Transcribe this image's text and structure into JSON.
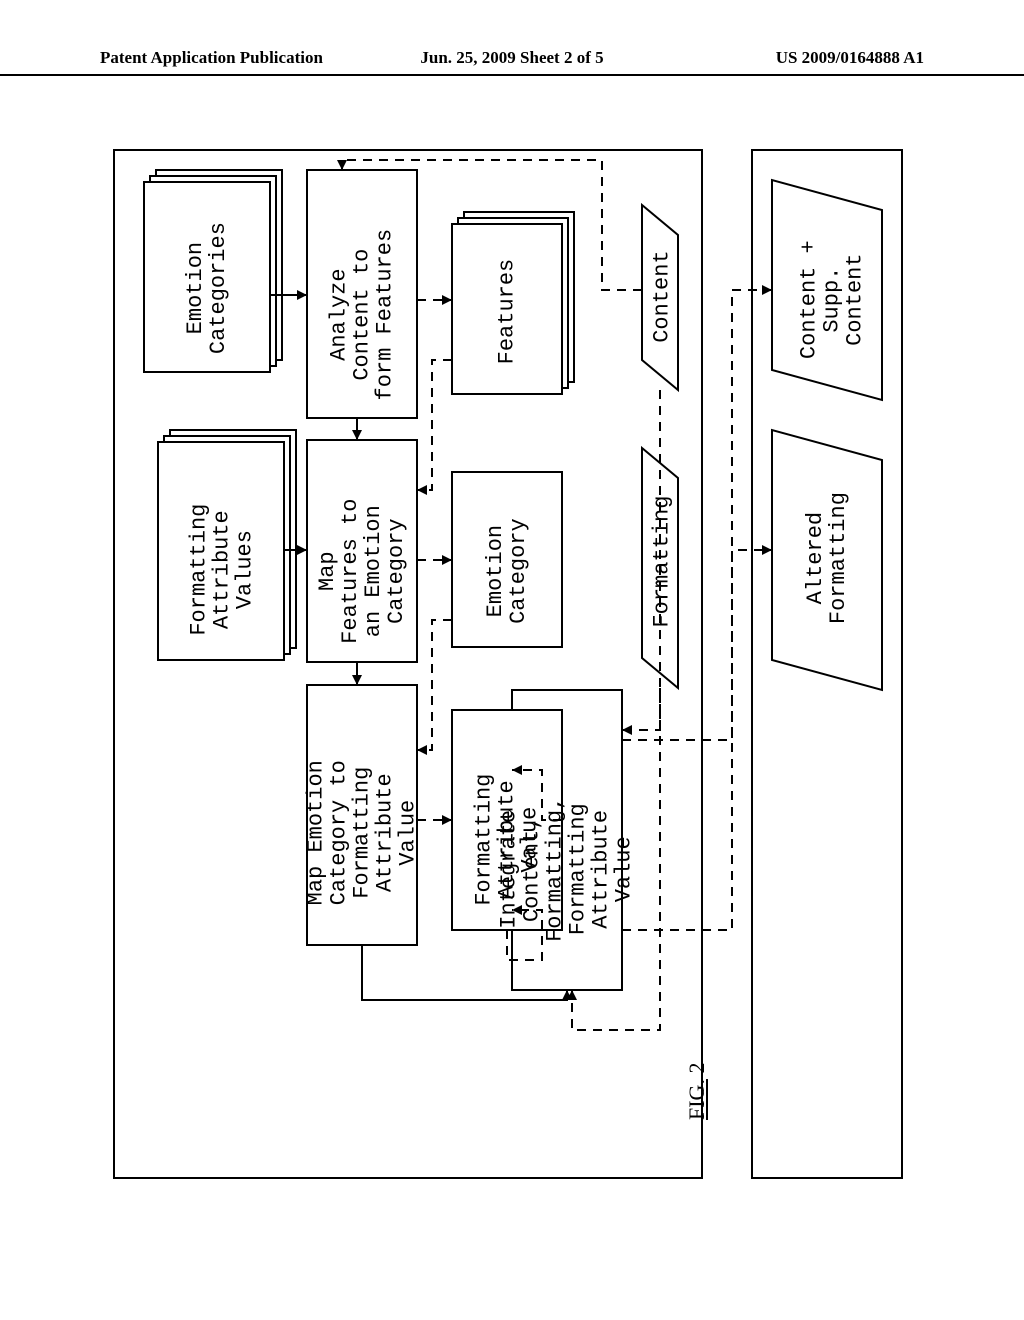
{
  "header": {
    "left": "Patent Application Publication",
    "center": "Jun. 25, 2009  Sheet 2 of 5",
    "right": "US 2009/0164888 A1"
  },
  "figure_label": {
    "prefix": "FIG.",
    "number": "2"
  },
  "boxes": {
    "analyze": "Analyze\nContent to\nform Features",
    "map_features": "Map\nFeatures to\nan Emotion\nCategory",
    "map_emotion": "Map Emotion\nCategory to\nFormatting\nAttribute\nValue",
    "emotion_categories": "Emotion\nCategories",
    "formatting_attr_values": "Formatting\nAttribute\nValues",
    "features": "Features",
    "emotion_category": "Emotion\nCategory",
    "formatting_attr_value": "Formatting\nAttribute\nValue",
    "integrate": "Integrate\nContent,\nFormatting,\nFormatting\nAttribute\nValue",
    "content": "Content",
    "formatting": "Formatting",
    "content_supp": "Content +\nSupp.\nContent",
    "altered_formatting": "Altered\nFormatting"
  }
}
